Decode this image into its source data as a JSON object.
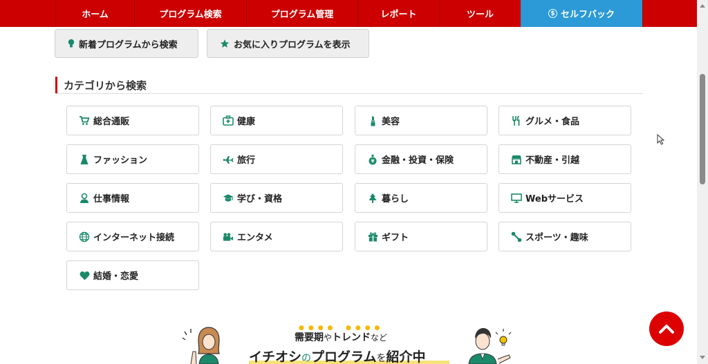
{
  "nav": {
    "items": [
      {
        "label": "ホーム"
      },
      {
        "label": "プログラム検索"
      },
      {
        "label": "プログラム管理"
      },
      {
        "label": "レポート"
      },
      {
        "label": "ツール"
      },
      {
        "label": "セルフバック"
      }
    ],
    "colors": {
      "nav_bg": "#cc0000",
      "selfback_bg": "#2b9ad6"
    }
  },
  "quick_buttons": {
    "new_programs": "新着プログラムから検索",
    "favorites": "お気に入りプログラムを表示"
  },
  "category_section": {
    "heading": "カテゴリから検索",
    "icon_color": "#1a8a6a",
    "categories": [
      {
        "label": "総合通販",
        "icon": "cart-icon"
      },
      {
        "label": "健康",
        "icon": "first-aid-kit-icon"
      },
      {
        "label": "美容",
        "icon": "lipstick-icon"
      },
      {
        "label": "グルメ・食品",
        "icon": "fork-knife-icon"
      },
      {
        "label": "ファッション",
        "icon": "dress-icon"
      },
      {
        "label": "旅行",
        "icon": "airplane-icon"
      },
      {
        "label": "金融・投資・保険",
        "icon": "money-bag-icon"
      },
      {
        "label": "不動産・引越",
        "icon": "store-icon"
      },
      {
        "label": "仕事情報",
        "icon": "worker-icon"
      },
      {
        "label": "学び・資格",
        "icon": "graduation-cap-icon"
      },
      {
        "label": "暮らし",
        "icon": "tree-icon"
      },
      {
        "label": "Webサービス",
        "icon": "monitor-icon"
      },
      {
        "label": "インターネット接続",
        "icon": "globe-icon"
      },
      {
        "label": "エンタメ",
        "icon": "video-camera-icon"
      },
      {
        "label": "ギフト",
        "icon": "gift-icon"
      },
      {
        "label": "スポーツ・趣味",
        "icon": "dumbbell-icon"
      },
      {
        "label": "結婚・恋愛",
        "icon": "heart-icon"
      }
    ]
  },
  "banner": {
    "sub_strong": "需要期",
    "sub_small_1": "や",
    "sub_strong_2": "トレンド",
    "sub_small_2": "など",
    "title_a": "イチオシ",
    "title_b": "の",
    "title_c": "プログラム",
    "title_d": "を",
    "title_e": "紹介中"
  }
}
